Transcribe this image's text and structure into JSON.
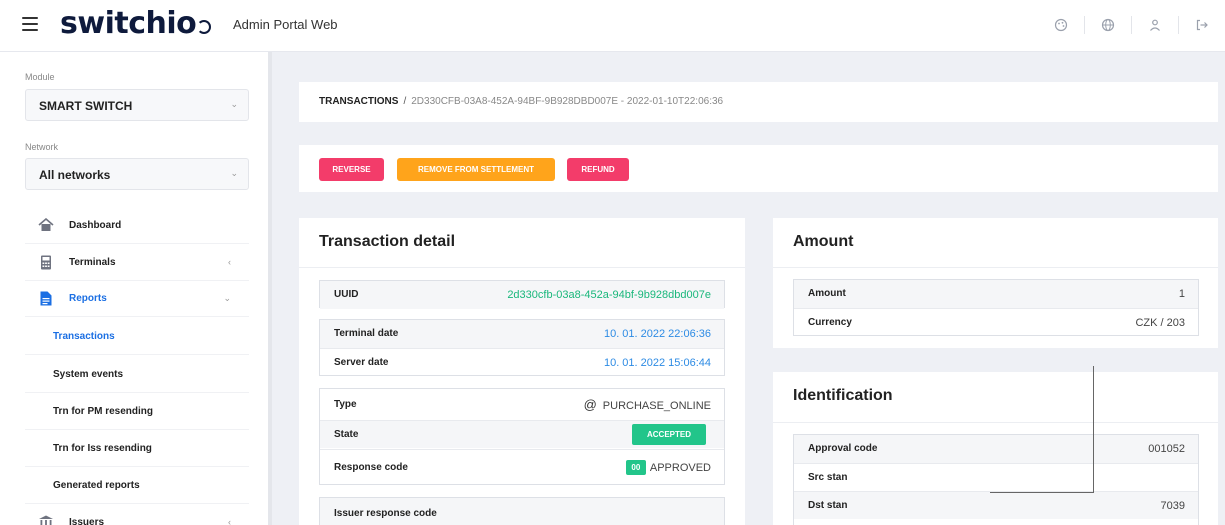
{
  "header": {
    "logo": "switchio",
    "portal_name": "Admin Portal Web",
    "icons": [
      "palette-icon",
      "globe-icon",
      "user-icon",
      "logout-icon"
    ]
  },
  "sidebar": {
    "module_label": "Module",
    "module_value": "SMART SWITCH",
    "network_label": "Network",
    "network_value": "All networks",
    "nav": [
      {
        "label": "Dashboard",
        "icon": "home-icon"
      },
      {
        "label": "Terminals",
        "icon": "terminal-icon"
      },
      {
        "label": "Reports",
        "icon": "file-icon"
      },
      {
        "label": "Issuers",
        "icon": "bank-icon"
      }
    ],
    "reports_sub": [
      "Transactions",
      "System events",
      "Trn for PM resending",
      "Trn for Iss resending",
      "Generated reports"
    ]
  },
  "breadcrumb": {
    "root": "TRANSACTIONS",
    "separator": "/",
    "current": "2D330CFB-03A8-452A-94BF-9B928DBD007E - 2022-01-10T22:06:36"
  },
  "actions": {
    "reverse": "REVERSE",
    "remove": "REMOVE FROM SETTLEMENT",
    "refund": "REFUND"
  },
  "transaction_detail": {
    "title": "Transaction detail",
    "uuid_label": "UUID",
    "uuid_value": "2d330cfb-03a8-452a-94bf-9b928dbd007e",
    "terminal_date_label": "Terminal date",
    "terminal_date_value": "10. 01. 2022 22:06:36",
    "server_date_label": "Server date",
    "server_date_value": "10. 01. 2022 15:06:44",
    "type_label": "Type",
    "type_symbol": "@",
    "type_value": "PURCHASE_ONLINE",
    "state_label": "State",
    "state_value": "ACCEPTED",
    "response_code_label": "Response code",
    "response_code_badge": "00",
    "response_code_value": "APPROVED",
    "issuer_response_label": "Issuer response code"
  },
  "amount_card": {
    "title": "Amount",
    "amount_label": "Amount",
    "amount_value": "1",
    "currency_label": "Currency",
    "currency_value": "CZK / 203"
  },
  "identification": {
    "title": "Identification",
    "approval_code_label": "Approval code",
    "approval_code_value": "001052",
    "src_stan_label": "Src stan",
    "src_stan_value": "",
    "dst_stan_label": "Dst stan",
    "dst_stan_value": "7039"
  },
  "colors": {
    "accent": "#1b6fe3",
    "danger": "#f33c6a",
    "warning": "#ffa41b",
    "success": "#22c58a",
    "uuid_green": "#19b77b",
    "date_blue": "#2d8be4"
  }
}
